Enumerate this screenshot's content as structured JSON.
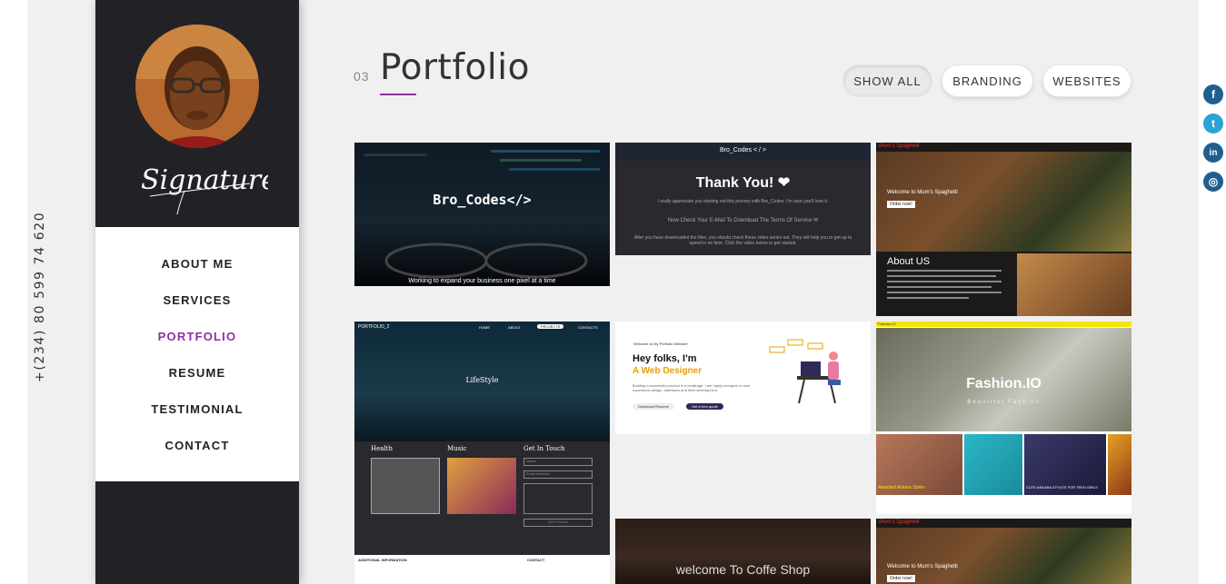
{
  "phone": "+(234) 80 599 74 620",
  "signature": "Signature",
  "menu": [
    {
      "label": "ABOUT ME"
    },
    {
      "label": "SERVICES"
    },
    {
      "label": "PORTFOLIO"
    },
    {
      "label": "RESUME"
    },
    {
      "label": "TESTIMONIAL"
    },
    {
      "label": "CONTACT"
    }
  ],
  "active_menu": "PORTFOLIO",
  "section": {
    "number": "03",
    "title": "Portfolio"
  },
  "filters": [
    {
      "label": "SHOW ALL",
      "active": true
    },
    {
      "label": "BRANDING",
      "active": false
    },
    {
      "label": "WEBSITES",
      "active": false
    }
  ],
  "social": [
    {
      "icon": "facebook-icon",
      "glyph": "f"
    },
    {
      "icon": "twitter-icon",
      "glyph": "t"
    },
    {
      "icon": "linkedin-icon",
      "glyph": "in"
    },
    {
      "icon": "instagram-icon",
      "glyph": "◎"
    }
  ],
  "colors": {
    "accent": "#8f2fa6",
    "sidebar": "#222126",
    "page_bg": "#f0f0f0"
  },
  "tiles": {
    "bro_codes": {
      "title": "Bro_Codes</>",
      "tagline": "Working to expand your business one pixel at a time"
    },
    "thank_you": {
      "nav": "Bro_Codes < / >",
      "heading": "Thank You! ❤",
      "line1": "I really appreciate you starting out this journey with Bro_Codes. I'm sure you'll love it.",
      "line2": "Now Check Your E-Mail To Download The Terms Of Service ✉",
      "line3": "After you have downloaded the files, you should check these video series out. They will help you to get up to speed in no time. Click the video below to get started."
    },
    "mums": {
      "brand": "Mum's Spaghetti",
      "welcome": "Welcome to Mum's Spaghetti",
      "button": "Order now!",
      "about": "About US"
    },
    "portfolio2": {
      "brand": "PORTFOLIO_2",
      "nav": [
        "HOME",
        "ABOUT",
        "PROJECTS",
        "CONTACTS"
      ],
      "hero": "LifeStyle",
      "health": "Health",
      "music": "Music",
      "contact": "Get In Touch",
      "name_ph": "Name",
      "email_ph": "Email Address",
      "submit": "Get In Touch",
      "footer_info": "ADDITIONAL INFORMATION",
      "footer_contact": "CONTACT"
    },
    "designer": {
      "small": "Welcome to My Portfolio Website!",
      "h1": "Hey folks, I'm",
      "h2": "A Web Designer",
      "desc": "Building a successful product is a challenge. I am highly energetic in user experience design, interfaces and Web development.",
      "btn1": "Download Resume",
      "btn2": "Get a free quote"
    },
    "fashion": {
      "brand": "Fashion.IO",
      "title": "Fashion.IO",
      "sub": "Beautiful Fashion",
      "cap1": "Awarded Ankara Styles",
      "cap2": "CUTE ANKARA STYLES FOR TEEN GIRLS"
    },
    "coffee": {
      "title": "welcome To Coffe Shop"
    },
    "mums2": {
      "brand": "Mum's Spaghetti",
      "welcome": "Welcome to Mum's Spaghetti",
      "button": "Order now!"
    }
  }
}
